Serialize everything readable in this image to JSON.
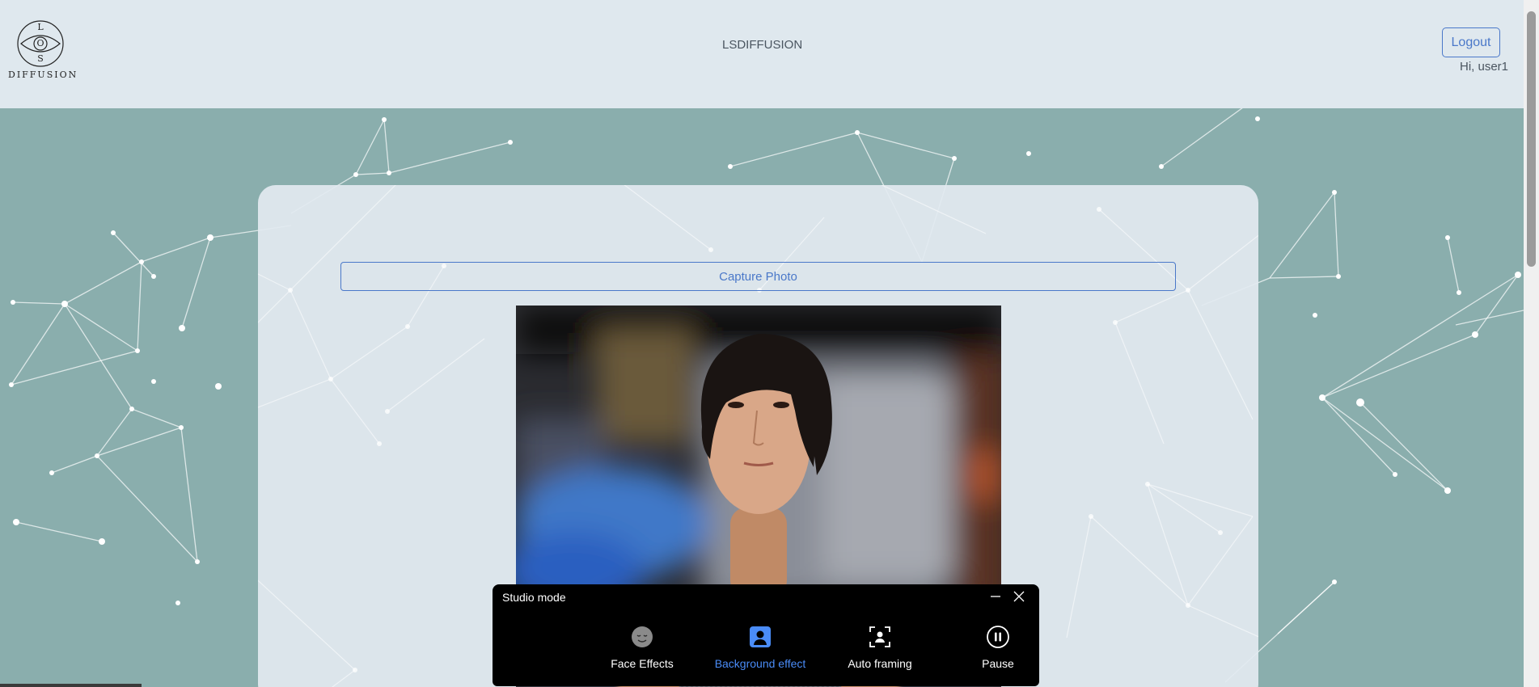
{
  "header": {
    "logo_letters": [
      "L",
      "O",
      "S"
    ],
    "logo_text": "DIFFUSION",
    "title": "LSDIFFUSION",
    "logout_label": "Logout",
    "greeting": "Hi, user1"
  },
  "main": {
    "capture_label": "Capture Photo"
  },
  "studio": {
    "title": "Studio mode",
    "options": [
      {
        "label": "Face Effects",
        "icon": "face-icon",
        "active": false
      },
      {
        "label": "Background effect",
        "icon": "person-portrait-icon",
        "active": true
      },
      {
        "label": "Auto framing",
        "icon": "frame-person-icon",
        "active": false
      },
      {
        "label": "Pause",
        "icon": "pause-icon",
        "active": false
      }
    ]
  },
  "colors": {
    "background": "#8aaead",
    "header": "#dfe8ee",
    "accent": "#4a78c9",
    "studio_active": "#4a8cf7"
  }
}
